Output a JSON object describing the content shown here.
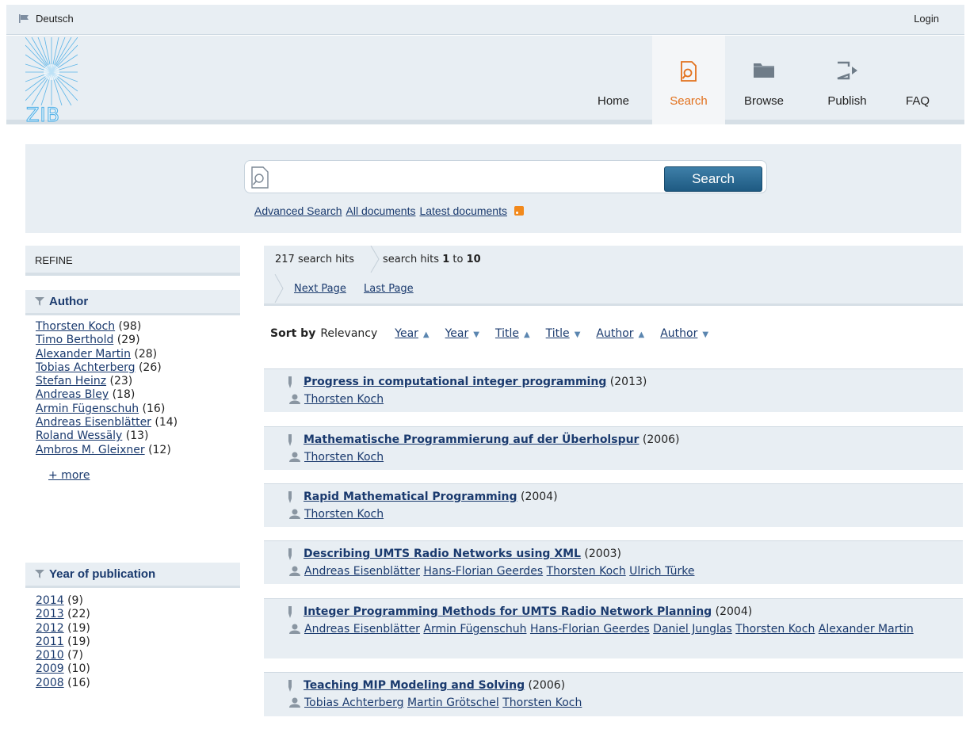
{
  "topbar": {
    "language": "Deutsch",
    "login": "Login"
  },
  "logo": {
    "text": "ZIB"
  },
  "nav": [
    {
      "label": "Home",
      "icon": "home"
    },
    {
      "label": "Search",
      "icon": "search-doc-icon",
      "active": true
    },
    {
      "label": "Browse",
      "icon": "folder-icon"
    },
    {
      "label": "Publish",
      "icon": "publish-icon"
    },
    {
      "label": "FAQ",
      "icon": "faq"
    }
  ],
  "search": {
    "placeholder": "",
    "button_label": "Search",
    "links": [
      "Advanced Search",
      "All documents",
      "Latest documents"
    ]
  },
  "refine": {
    "heading": "REFINE"
  },
  "author_facet": {
    "heading": "Author",
    "items": [
      {
        "name": "Thorsten Koch",
        "count": "(98)"
      },
      {
        "name": "Timo Berthold",
        "count": "(29)"
      },
      {
        "name": "Alexander Martin",
        "count": "(28)"
      },
      {
        "name": "Tobias Achterberg",
        "count": "(26)"
      },
      {
        "name": "Stefan Heinz",
        "count": "(23)"
      },
      {
        "name": "Andreas Bley",
        "count": "(18)"
      },
      {
        "name": "Armin Fügenschuh",
        "count": "(16)"
      },
      {
        "name": "Andreas Eisenblätter",
        "count": "(14)"
      },
      {
        "name": "Roland Wessäly",
        "count": "(13)"
      },
      {
        "name": "Ambros M. Gleixner",
        "count": "(12)"
      }
    ],
    "more": "+ more"
  },
  "year_facet": {
    "heading": "Year of publication",
    "items": [
      {
        "name": "2014",
        "count": "(9)"
      },
      {
        "name": "2013",
        "count": "(22)"
      },
      {
        "name": "2012",
        "count": "(19)"
      },
      {
        "name": "2011",
        "count": "(19)"
      },
      {
        "name": "2010",
        "count": "(7)"
      },
      {
        "name": "2009",
        "count": "(10)"
      },
      {
        "name": "2008",
        "count": "(16)"
      }
    ]
  },
  "paging": {
    "hits": "217 search hits",
    "range_prefix": "search hits",
    "range_from": "1",
    "range_to_word": "to",
    "range_to": "10",
    "next": "Next Page",
    "last": "Last Page"
  },
  "sort": {
    "label": "Sort by",
    "current": "Relevancy",
    "options": [
      {
        "label": "Year",
        "dir": "up"
      },
      {
        "label": "Year",
        "dir": "down"
      },
      {
        "label": "Title",
        "dir": "up"
      },
      {
        "label": "Title",
        "dir": "down"
      },
      {
        "label": "Author",
        "dir": "up"
      },
      {
        "label": "Author",
        "dir": "down"
      }
    ]
  },
  "results": [
    {
      "title": "Progress in computational integer programming",
      "year": "(2013)",
      "authors": [
        "Thorsten Koch"
      ]
    },
    {
      "title": "Mathematische Programmierung auf der Überholspur",
      "year": "(2006)",
      "authors": [
        "Thorsten Koch"
      ]
    },
    {
      "title": "Rapid Mathematical Programming",
      "year": "(2004)",
      "authors": [
        "Thorsten Koch"
      ]
    },
    {
      "title": "Describing UMTS Radio Networks using XML",
      "year": "(2003)",
      "authors": [
        "Andreas Eisenblätter",
        "Hans-Florian Geerdes",
        "Thorsten Koch",
        "Ulrich Türke"
      ]
    },
    {
      "title": "Integer Programming Methods for UMTS Radio Network Planning",
      "year": "(2004)",
      "authors": [
        "Andreas Eisenblätter",
        "Armin Fügenschuh",
        "Hans-Florian Geerdes",
        "Daniel Junglas",
        "Thorsten Koch",
        "Alexander Martin"
      ]
    },
    {
      "title": "Teaching MIP Modeling and Solving",
      "year": "(2006)",
      "authors": [
        "Tobias Achterberg",
        "Martin Grötschel",
        "Thorsten Koch"
      ]
    }
  ],
  "colors": {
    "accent": "#e2711d",
    "link": "#1a3a6e",
    "panel": "#e8eef3",
    "button": "#1e5a82"
  }
}
